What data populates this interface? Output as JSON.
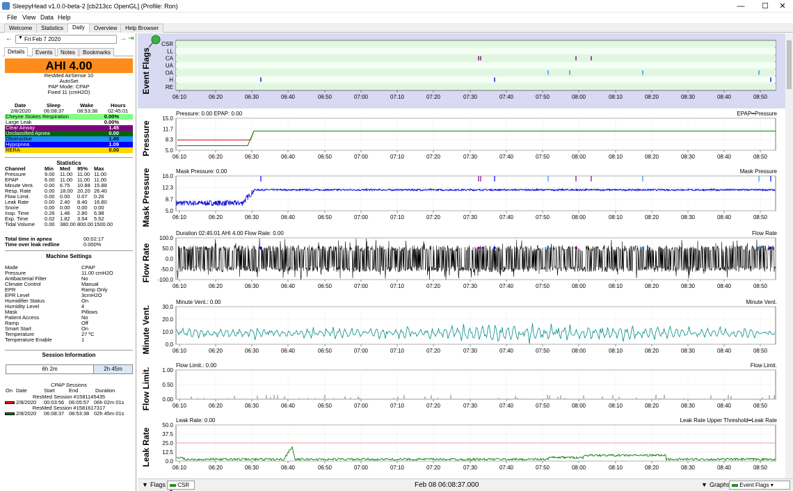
{
  "window": {
    "title": "SleepyHead v1.0.0-beta-2 [cb213cc OpenGL] (Profile: Ron)",
    "minimize": "—",
    "maximize": "☐",
    "close": "✕"
  },
  "menu": [
    "File",
    "View",
    "Data",
    "Help"
  ],
  "tabs": [
    "Welcome",
    "Statistics",
    "Daily",
    "Overview",
    "Help Browser"
  ],
  "date_nav": {
    "date": "Fri Feb 7 2020"
  },
  "left_tabs": [
    "Details",
    "Events",
    "Notes",
    "Bookmarks"
  ],
  "ahi": "AHI 4.00",
  "machine": [
    "ResMed AirSense 10",
    "AutoSet",
    "PAP Mode: CPAP",
    "Fixed 11 (cmH2O)"
  ],
  "summary": {
    "headers": [
      "Date",
      "Sleep",
      "Wake",
      "Hours"
    ],
    "values": [
      "2/8/2020",
      "06:08:37",
      "08:53:38",
      "02:45:01"
    ]
  },
  "events": [
    {
      "name": "Cheyne Stokes Respiration",
      "value": "0.00%",
      "bg": "#80ff80",
      "fg": "#000000"
    },
    {
      "name": "Large Leak",
      "value": "0.00%",
      "bg": "#ffffff",
      "fg": "#000000"
    },
    {
      "name": "Clear Airway",
      "value": "1.45",
      "bg": "#800080",
      "fg": "#ffffff"
    },
    {
      "name": "Unclassified Apnea",
      "value": "0.00",
      "bg": "#006400",
      "fg": "#ffffff"
    },
    {
      "name": "Obstructive",
      "value": "1.45",
      "bg": "#1e90ff",
      "fg": "#000000"
    },
    {
      "name": "Hypopnea",
      "value": "1.09",
      "bg": "#0000ff",
      "fg": "#ffffff"
    },
    {
      "name": "RERA",
      "value": "0.00",
      "bg": "#ffd700",
      "fg": "#000000"
    }
  ],
  "statistics": {
    "title": "Statistics",
    "headers": [
      "Channel",
      "Min",
      "Med",
      "95%",
      "Max"
    ],
    "rows": [
      [
        "Pressure",
        "9.00",
        "11.00",
        "11.00",
        "11.00"
      ],
      [
        "EPAP",
        "6.00",
        "11.00",
        "11.00",
        "11.00"
      ],
      [
        "Minute Vent.",
        "0.00",
        "6.75",
        "10.88",
        "15.88"
      ],
      [
        "Resp. Rate",
        "0.00",
        "18.00",
        "20.20",
        "26.40"
      ],
      [
        "Flow Limit.",
        "0.00",
        "0.00",
        "0.07",
        "0.26"
      ],
      [
        "Leak Rate",
        "0.00",
        "2.40",
        "8.40",
        "16.80"
      ],
      [
        "Snore",
        "0.00",
        "0.00",
        "0.00",
        "0.00"
      ],
      [
        "Insp. Time",
        "0.26",
        "1.46",
        "2.80",
        "6.98"
      ],
      [
        "Exp. Time",
        "0.02",
        "1.82",
        "3.54",
        "5.52"
      ],
      [
        "Tidal Volume",
        "0.00",
        "380.00",
        "800.00",
        "1500.00"
      ]
    ]
  },
  "apnea": [
    {
      "label": "Total time in apnea",
      "value": "00:02:17"
    },
    {
      "label": "Time over leak redline",
      "value": "0.000%"
    }
  ],
  "settings": {
    "title": "Machine Settings",
    "rows": [
      [
        "Mode",
        "CPAP"
      ],
      [
        "Pressure",
        "11.00 cmH2O"
      ],
      [
        "Antibacterial Filter",
        "No"
      ],
      [
        "Climate Control",
        "Manual"
      ],
      [
        "EPR",
        "Ramp Only"
      ],
      [
        "EPR Level",
        "3cmH2O"
      ],
      [
        "Humidifier Status",
        "On"
      ],
      [
        "Humidity Level",
        "4"
      ],
      [
        "Mask",
        "Pillows"
      ],
      [
        "Patient Access",
        "No"
      ],
      [
        "Ramp",
        "Off"
      ],
      [
        "Smart Start",
        "On"
      ],
      [
        "Temperature",
        "27 ºC"
      ],
      [
        "Temperature Enable",
        "1"
      ]
    ]
  },
  "session_info": {
    "title": "Session Information",
    "bar1": "6h 2m",
    "bar2": "2h 45m",
    "caption": "CPAP Sessions",
    "headers": [
      "On",
      "Date",
      "Start",
      "End",
      "Duration"
    ],
    "sessions": [
      {
        "name": "ResMed Session #1581145435",
        "date": "2/8/2020",
        "start": "00:03:56",
        "end": "06:05:57",
        "dur": "06h 02m 01s",
        "color": "#ff0000"
      },
      {
        "name": "ResMed Session #1581617317",
        "date": "2/8/2020",
        "start": "06:08:37",
        "end": "08:53:38",
        "dur": "02h 45m 01s",
        "color": "#008000"
      }
    ]
  },
  "x_ticks": [
    "06:10",
    "06:20",
    "06:30",
    "06:40",
    "06:50",
    "07:00",
    "07:10",
    "07:20",
    "07:30",
    "07:40",
    "07:50",
    "08:00",
    "08:10",
    "08:20",
    "08:30",
    "08:40",
    "08:50"
  ],
  "graphs": {
    "flags": {
      "label": "Event Flags",
      "rows": [
        "CSR",
        "LL",
        "CA",
        "UA",
        "OA",
        "H",
        "RE"
      ]
    },
    "pressure": {
      "label": "Pressure",
      "title": "Pressure: 0.00 EPAP: 0.00",
      "legend": "EPAP━Pressure",
      "yticks": [
        "15.0",
        "11.7",
        "8.3",
        "5.0"
      ]
    },
    "mask": {
      "label": "Mask Pressure",
      "title": "Mask Pressure: 0.00",
      "legend": "Mask Pressure",
      "yticks": [
        "16.0",
        "12.3",
        "8.7",
        "5.0"
      ]
    },
    "flow": {
      "label": "Flow Rate",
      "title": "Duration 02:45:01 AHI 4.00 Flow Rate: 0.00",
      "legend": "Flow Rate",
      "yticks": [
        "100.0",
        "50.0",
        "0.0",
        "-50.0",
        "-100.0"
      ]
    },
    "minvent": {
      "label": "Minute Vent.",
      "title": "Minute Vent.: 0.00",
      "legend": "Minute Vent.",
      "yticks": [
        "30.0",
        "20.0",
        "10.0",
        "0.0"
      ]
    },
    "flowlim": {
      "label": "Flow Limit.",
      "title": "Flow Limit.: 0.00",
      "legend": "Flow Limit.",
      "yticks": [
        "1.00",
        "0.50",
        "0.00"
      ]
    },
    "leak": {
      "label": "Leak Rate",
      "title": "Leak Rate: 0.00",
      "legend": "Leak Rate Upper Threshold━Leak Rate",
      "yticks": [
        "50.0",
        "37.5",
        "25.0",
        "12.5",
        "0.0"
      ]
    }
  },
  "bottom": {
    "flags": "Flags",
    "csr": "CSR",
    "timestamp": "Feb 08 06:08:37.000",
    "graphs": "Graphs",
    "eventflags": "Event Flags"
  }
}
